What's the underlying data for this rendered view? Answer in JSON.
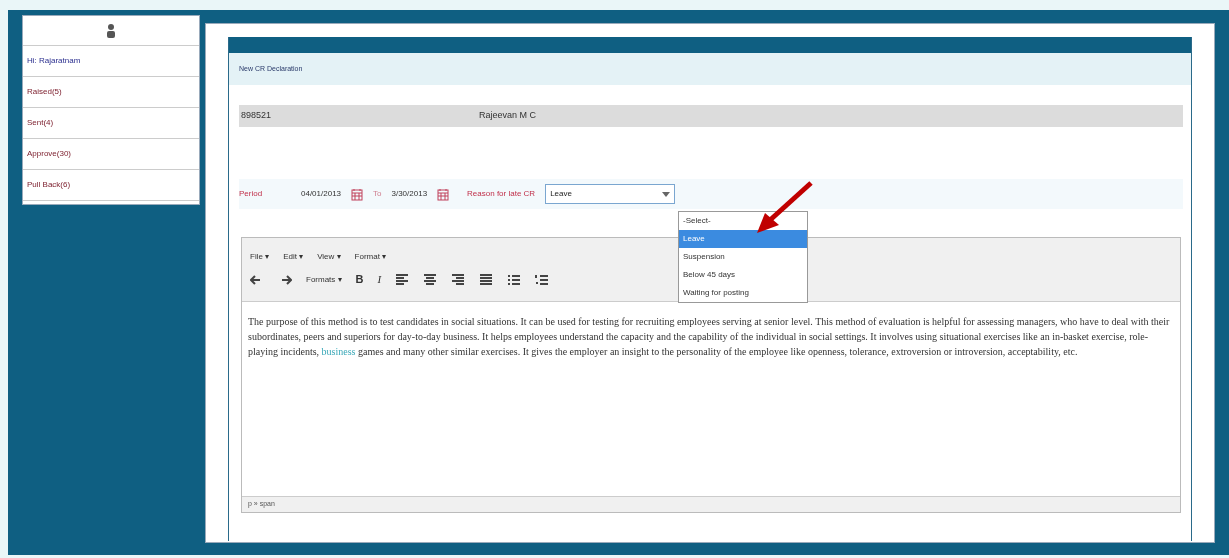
{
  "sidebar": {
    "greeting": "Hi: Rajaratnam",
    "items": [
      {
        "label": "Raised(5)",
        "selected": false
      },
      {
        "label": "Sent(4)",
        "selected": false
      },
      {
        "label": "Approve(30)",
        "selected": false
      },
      {
        "label": "Pull Back(6)",
        "selected": false
      }
    ]
  },
  "panel": {
    "title": "New CR Declaration"
  },
  "employee": {
    "id": "898521",
    "name": "Rajeevan M C"
  },
  "period": {
    "label": "Period",
    "from": "04/01/2013",
    "to_label": "To",
    "to": "3/30/2013"
  },
  "reason": {
    "label": "Reason for late CR",
    "value": "Leave",
    "expanded": true,
    "options": [
      {
        "label": "-Select-",
        "selected": false
      },
      {
        "label": "Leave",
        "selected": true
      },
      {
        "label": "Suspension",
        "selected": false
      },
      {
        "label": "Below 45 days",
        "selected": false
      },
      {
        "label": "Waiting for posting",
        "selected": false
      }
    ]
  },
  "editor": {
    "menus": [
      "File ▾",
      "Edit ▾",
      "View ▾",
      "Format ▾"
    ],
    "formats": "Formats ▾",
    "bold": "B",
    "italic": "I",
    "content": "The purpose of this method is to test candidates in social situations. It can be used for testing for recruiting employees serving at senior level. This method of evaluation is helpful for assessing managers, who have to deal with their subordinates, peers and superiors for day-to-day business. It helps employees understand the capacity and the capability of the individual in social settings. It involves using situational exercises like an in-basket exercise, role-playing incidents,",
    "link": "business",
    "content_after": "games and many other similar exercises. It gives the employer an insight to the personality of the employee like openness, tolerance, extroversion or introversion, acceptability, etc.",
    "status": "p » span"
  }
}
